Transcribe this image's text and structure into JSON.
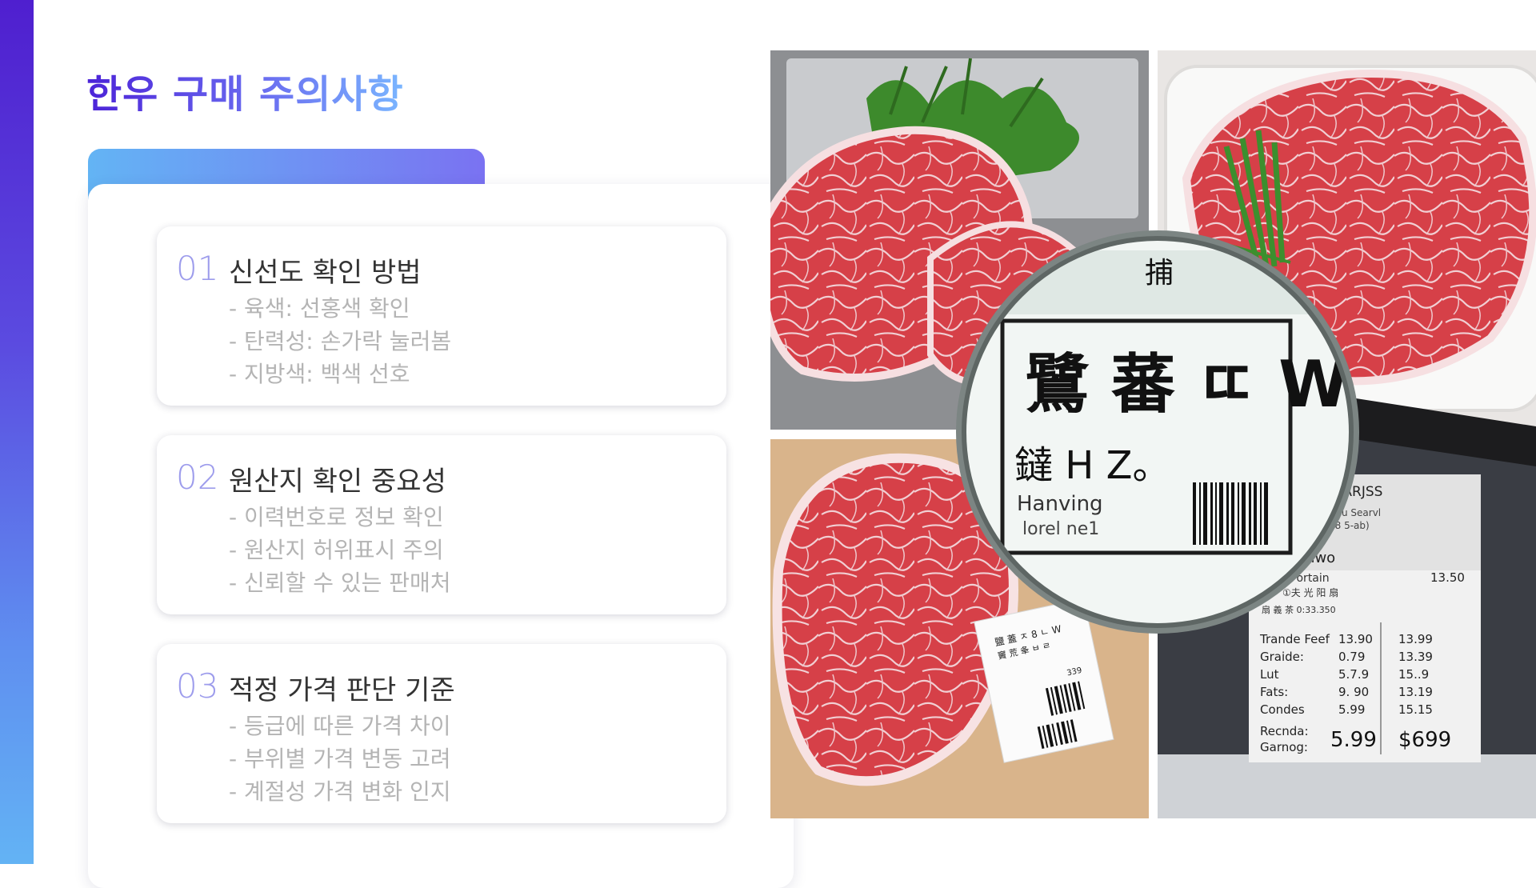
{
  "title": "한우 구매 주의사항",
  "tips": [
    {
      "num": "01",
      "title": "신선도 확인 방법",
      "lines": [
        "육색: 선홍색 확인",
        "탄력성: 손가락 눌러봄",
        "지방색: 백색 선호"
      ]
    },
    {
      "num": "02",
      "title": "원산지 확인 중요성",
      "lines": [
        "이력번호로 정보 확인",
        "원산지 허위표시 주의",
        "신뢰할 수 있는 판매처"
      ]
    },
    {
      "num": "03",
      "title": "적정 가격 판단 기준",
      "lines": [
        "등급에 따른 가격 차이",
        "부위별 가격 변동 고려",
        "계절성 가격 변화 인지"
      ]
    }
  ],
  "photo": {
    "lens_main": "鷺 蕃 ㄸ W",
    "lens_top": "捕",
    "lens_sub": "鐽 H Z。",
    "lens_label_1": "Hanving",
    "lens_label_2": "lorel ne1",
    "tag_small_1": "鹽 蓋 ㅈ 8 ㄴ W",
    "tag_small_2": "竇 荒 夆 ㅂ ㄹ",
    "tag_small_3": "339",
    "price_header": "紫NTE PARJSS",
    "price_sub_1": "윤 GJ,S 8 of fu Searvl",
    "price_sub_2": "1:009-0,198 5-ab)",
    "price_name": "Tanwo",
    "price_line_1": "t Fortain",
    "price_line_1_val": "13.50",
    "price_line_2": "①夫 光 阳 扇",
    "price_line_3": "扇 義 茶 0:33.350",
    "price_rows": [
      {
        "label": "Trande Feef",
        "a": "13.90",
        "b": "13.99"
      },
      {
        "label": "Graide:",
        "a": "0.79",
        "b": "13.39"
      },
      {
        "label": "Lut",
        "a": "5.7.9",
        "b": "15..9"
      },
      {
        "label": "Fats:",
        "a": "9. 90",
        "b": "13.19"
      },
      {
        "label": "Condes",
        "a": "5.99",
        "b": "15.15"
      }
    ],
    "price_foot_1": "Recnda:",
    "price_foot_2": "Garnog:",
    "price_big_a": "5.99",
    "price_big_b": "$699",
    "colors": {
      "meat": "#d8424a",
      "fat": "#f3d8dc",
      "herb": "#3d8a2c",
      "steel": "#c9cbce"
    }
  }
}
